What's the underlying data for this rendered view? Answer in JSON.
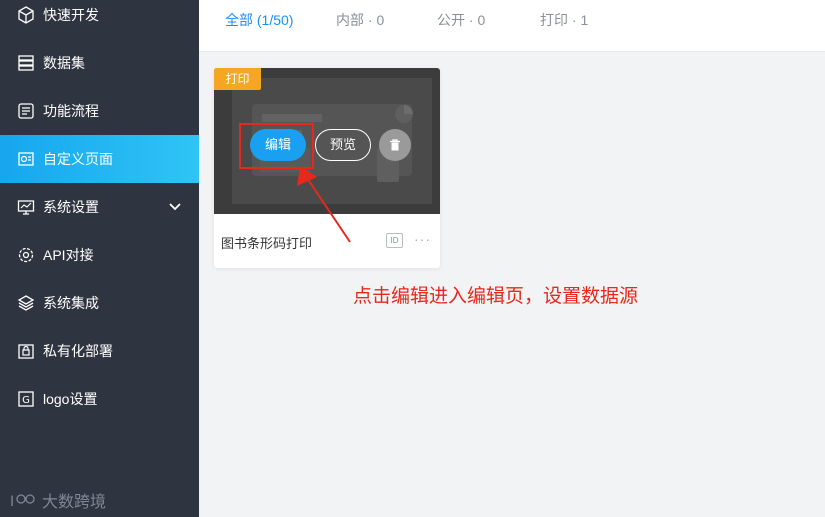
{
  "sidebar": {
    "items": [
      {
        "label": "快速开发",
        "icon": "cube-icon"
      },
      {
        "label": "数据集",
        "icon": "database-icon"
      },
      {
        "label": "功能流程",
        "icon": "flow-icon"
      },
      {
        "label": "自定义页面",
        "icon": "page-icon",
        "active": true
      },
      {
        "label": "系统设置",
        "icon": "monitor-icon",
        "expandable": true
      },
      {
        "label": "API对接",
        "icon": "gear-icon"
      },
      {
        "label": "系统集成",
        "icon": "layers-icon"
      },
      {
        "label": "私有化部署",
        "icon": "lock-icon"
      },
      {
        "label": "logo设置",
        "icon": "logo-frame-icon"
      }
    ],
    "brand": "大数跨境"
  },
  "tabs": [
    {
      "label": "全部 (1/50)",
      "active": true
    },
    {
      "label": "内部 · 0"
    },
    {
      "label": "公开 · 0"
    },
    {
      "label": "打印 · 1"
    }
  ],
  "card": {
    "badge": "打印",
    "edit_label": "编辑",
    "preview_label": "预览",
    "title": "图书条形码打印",
    "id_tag": "ID",
    "more": "···"
  },
  "annotation": "点击编辑进入编辑页，设置数据源",
  "colors": {
    "sidebar_bg": "#2f3441",
    "active_bg": "#1fb2f1",
    "accent": "#1890ff",
    "badge": "#f5a623",
    "annotation": "#e8281c"
  }
}
